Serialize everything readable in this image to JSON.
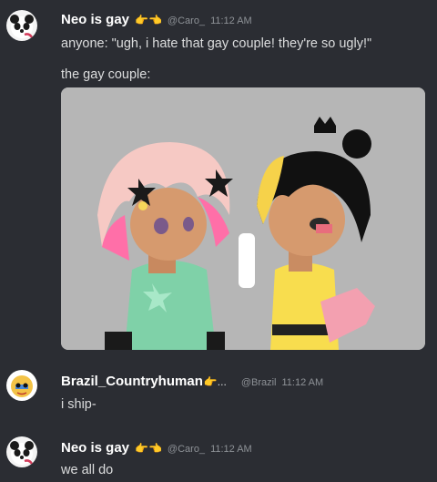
{
  "messages": [
    {
      "username": "Neo is gay",
      "emoji": "👉👈",
      "handle": "@Caro_",
      "time": "11:12 AM",
      "lines": [
        "anyone: \"ugh, i hate that gay couple! they're so ugly!\"",
        "the gay couple:"
      ]
    },
    {
      "username": "Brazil_Countryhuman",
      "emoji": "👉...",
      "handle": "@Brazil",
      "time": "11:12 AM",
      "lines": [
        "i ship-"
      ]
    },
    {
      "username": "Neo is gay",
      "emoji": "👉👈",
      "handle": "@Caro_",
      "time": "11:12 AM",
      "lines": [
        "we all do"
      ]
    }
  ],
  "colors": {
    "background": "#2b2d33",
    "username": "#ffffff",
    "meta": "#8e9297",
    "text": "#dcddde",
    "image_bg": "#b6b6b6"
  }
}
